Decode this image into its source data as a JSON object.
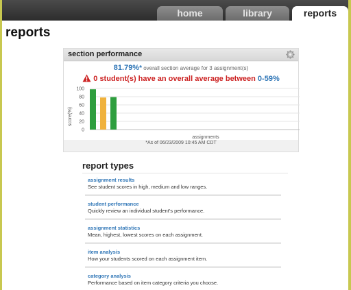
{
  "nav": {
    "tabs": [
      {
        "label": "home",
        "active": false
      },
      {
        "label": "library",
        "active": false
      },
      {
        "label": "reports",
        "active": true
      }
    ]
  },
  "page": {
    "title": "reports"
  },
  "section_performance": {
    "title": "section performance",
    "average_value": "81.79%",
    "average_marker": "*",
    "average_text": "overall section average for 3 assignment(s)",
    "warning_prefix": "0 student(s) have an overall average between",
    "warning_range": "0-59%",
    "footer": "*As of 06/23/2009 10:45 AM CDT",
    "colors": {
      "green": "#2e9e3e",
      "yellow": "#f0b23c",
      "blue": "#2e75b6",
      "red": "#cc2222"
    }
  },
  "chart_data": {
    "type": "bar",
    "ylabel": "score(%)",
    "xlabel": "assignments",
    "ylim": [
      0,
      100
    ],
    "yticks": [
      0,
      20,
      40,
      60,
      80,
      100
    ],
    "grid": true,
    "values": [
      98,
      78,
      79
    ],
    "colors": [
      "#2e9e3e",
      "#f0b23c",
      "#2e9e3e"
    ]
  },
  "report_types": {
    "heading": "report types",
    "items": [
      {
        "title": "assignment results",
        "description": "See student scores in high, medium and low ranges."
      },
      {
        "title": "student performance",
        "description": "Quickly review an individual student's performance."
      },
      {
        "title": "assignment statistics",
        "description": "Mean, highest, lowest scores on each assignment."
      },
      {
        "title": "item analysis",
        "description": "How your students scored on each assignment item."
      },
      {
        "title": "category analysis",
        "description": "Performance based on item category criteria you choose."
      }
    ]
  }
}
